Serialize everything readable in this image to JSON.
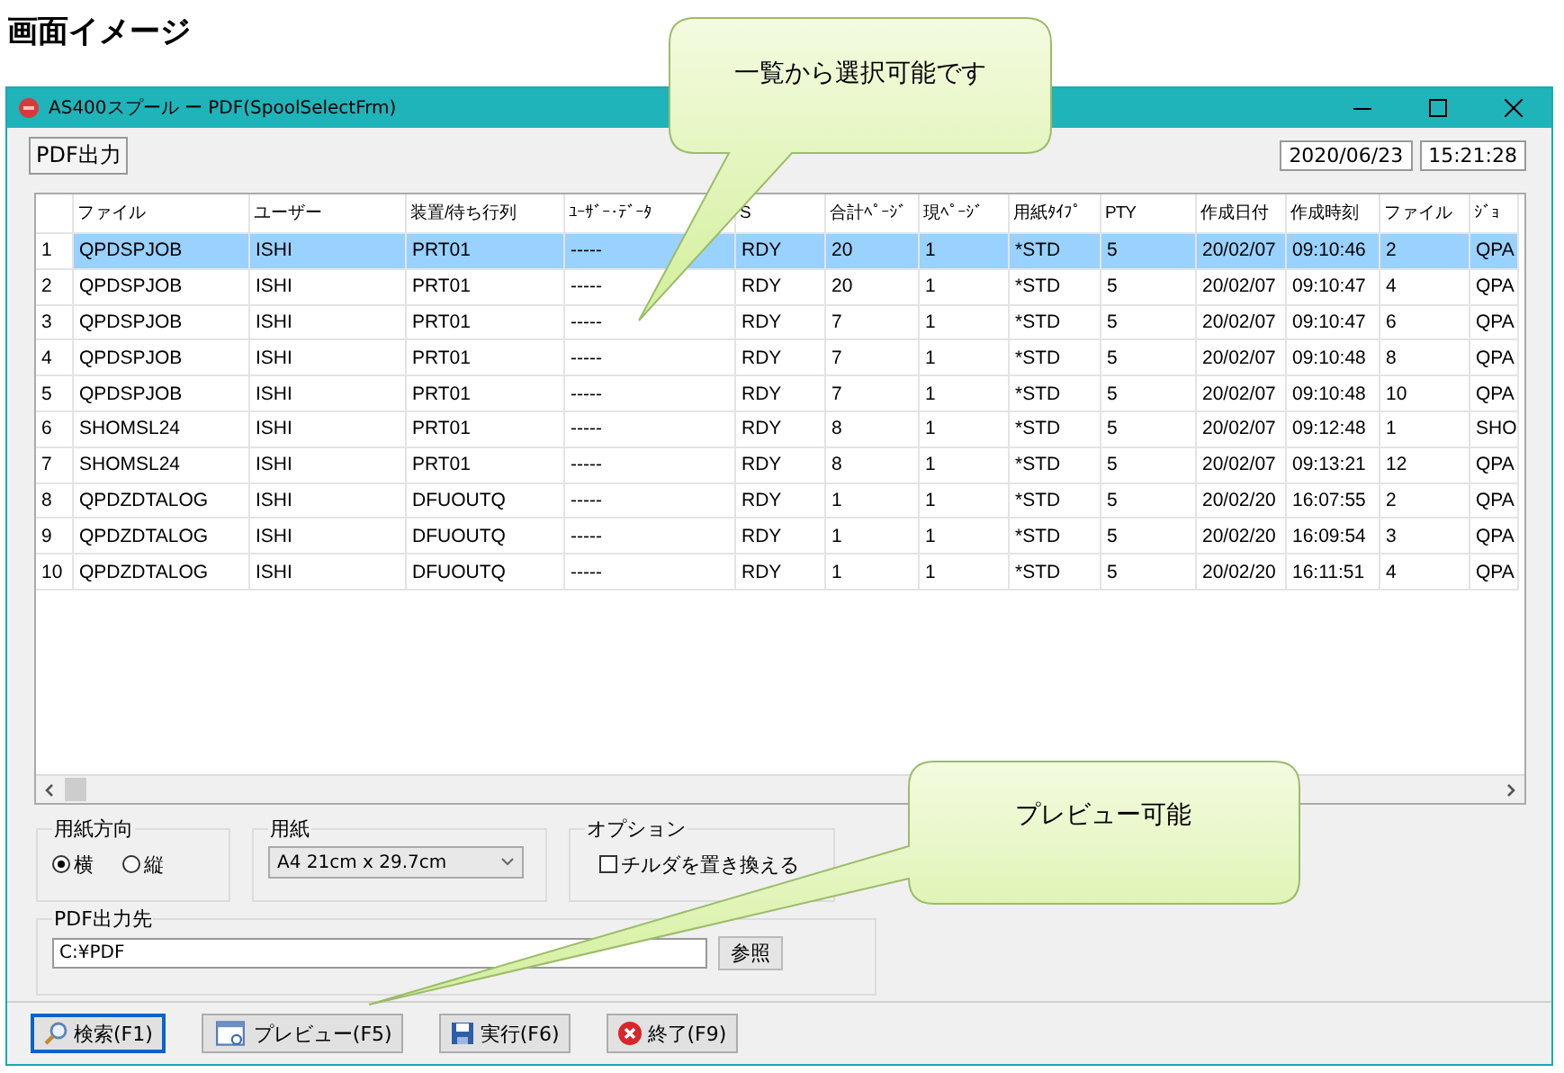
{
  "page_title": "画面イメージ",
  "window": {
    "title": "AS400スプール ー PDF(SpoolSelectFrm)"
  },
  "toolbar": {
    "label": "PDF出力",
    "date": "2020/06/23",
    "time": "15:21:28"
  },
  "table": {
    "columns": [
      "ファイル",
      "ユーザー",
      "装置/待ち行列",
      "ﾕｰｻﾞｰ･ﾃﾞｰﾀ",
      "S",
      "合計ﾍﾟｰｼﾞ",
      "現ﾍﾟｰｼﾞ",
      "用紙ﾀｲﾌﾟ",
      "PTY",
      "作成日付",
      "作成時刻",
      "ファイル",
      "ｼﾞｮ"
    ],
    "rows": [
      {
        "number": "1",
        "selected": true,
        "cells": [
          "QPDSPJOB",
          "ISHI",
          "PRT01",
          "-----",
          "RDY",
          "20",
          "1",
          "*STD",
          "5",
          "20/02/07",
          "09:10:46",
          "2",
          "QPA"
        ]
      },
      {
        "number": "2",
        "selected": false,
        "cells": [
          "QPDSPJOB",
          "ISHI",
          "PRT01",
          "-----",
          "RDY",
          "20",
          "1",
          "*STD",
          "5",
          "20/02/07",
          "09:10:47",
          "4",
          "QPA"
        ]
      },
      {
        "number": "3",
        "selected": false,
        "cells": [
          "QPDSPJOB",
          "ISHI",
          "PRT01",
          "-----",
          "RDY",
          "7",
          "1",
          "*STD",
          "5",
          "20/02/07",
          "09:10:47",
          "6",
          "QPA"
        ]
      },
      {
        "number": "4",
        "selected": false,
        "cells": [
          "QPDSPJOB",
          "ISHI",
          "PRT01",
          "-----",
          "RDY",
          "7",
          "1",
          "*STD",
          "5",
          "20/02/07",
          "09:10:48",
          "8",
          "QPA"
        ]
      },
      {
        "number": "5",
        "selected": false,
        "cells": [
          "QPDSPJOB",
          "ISHI",
          "PRT01",
          "-----",
          "RDY",
          "7",
          "1",
          "*STD",
          "5",
          "20/02/07",
          "09:10:48",
          "10",
          "QPA"
        ]
      },
      {
        "number": "6",
        "selected": false,
        "cells": [
          "SHOMSL24",
          "ISHI",
          "PRT01",
          "-----",
          "RDY",
          "8",
          "1",
          "*STD",
          "5",
          "20/02/07",
          "09:12:48",
          "1",
          "SHO"
        ]
      },
      {
        "number": "7",
        "selected": false,
        "cells": [
          "SHOMSL24",
          "ISHI",
          "PRT01",
          "-----",
          "RDY",
          "8",
          "1",
          "*STD",
          "5",
          "20/02/07",
          "09:13:21",
          "12",
          "QPA"
        ]
      },
      {
        "number": "8",
        "selected": false,
        "cells": [
          "QPDZDTALOG",
          "ISHI",
          "DFUOUTQ",
          "-----",
          "RDY",
          "1",
          "1",
          "*STD",
          "5",
          "20/02/20",
          "16:07:55",
          "2",
          "QPA"
        ]
      },
      {
        "number": "9",
        "selected": false,
        "cells": [
          "QPDZDTALOG",
          "ISHI",
          "DFUOUTQ",
          "-----",
          "RDY",
          "1",
          "1",
          "*STD",
          "5",
          "20/02/20",
          "16:09:54",
          "3",
          "QPA"
        ]
      },
      {
        "number": "10",
        "selected": false,
        "cells": [
          "QPDZDTALOG",
          "ISHI",
          "DFUOUTQ",
          "-----",
          "RDY",
          "1",
          "1",
          "*STD",
          "5",
          "20/02/20",
          "16:11:51",
          "4",
          "QPA"
        ]
      }
    ]
  },
  "orientation": {
    "label": "用紙方向",
    "options": [
      {
        "label": "横",
        "selected": true
      },
      {
        "label": "縦",
        "selected": false
      }
    ]
  },
  "paper": {
    "label": "用紙",
    "value": "A4 21cm x 29.7cm"
  },
  "options": {
    "label": "オプション",
    "items": [
      {
        "label": "チルダを置き換える",
        "checked": false
      }
    ]
  },
  "output": {
    "label": "PDF出力先",
    "value": "C:¥PDF",
    "browse": "参照"
  },
  "buttons": [
    {
      "label": "検索(F1)",
      "kind": "search",
      "focused": true
    },
    {
      "label": "プレビュー(F5)",
      "kind": "preview",
      "focused": false
    },
    {
      "label": "実行(F6)",
      "kind": "save",
      "focused": false
    },
    {
      "label": "終了(F9)",
      "kind": "exit",
      "focused": false
    }
  ],
  "callouts": [
    {
      "text": "一覧から選択可能です"
    },
    {
      "text": "プレビュー可能"
    }
  ]
}
